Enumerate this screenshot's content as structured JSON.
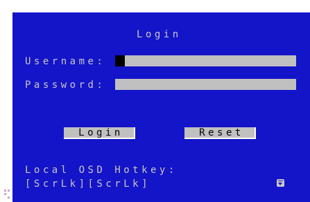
{
  "login_dialog": {
    "title": "Login",
    "username_label": "Username:",
    "password_label": "Password:",
    "username_value": "",
    "password_value": "",
    "login_button_label": "Login",
    "reset_button_label": "Reset",
    "hotkey_label": "Local OSD Hotkey:",
    "hotkey_value": "[ScrLk][ScrLk]"
  },
  "icons": {
    "scroll_icon": "scroll-down-icon",
    "corner_marker": "resize-corner-icon"
  },
  "colors": {
    "panel_background": "#1414c8",
    "text": "#c8c8c8",
    "field_background": "#c0c0c0",
    "button_text": "#000000"
  }
}
